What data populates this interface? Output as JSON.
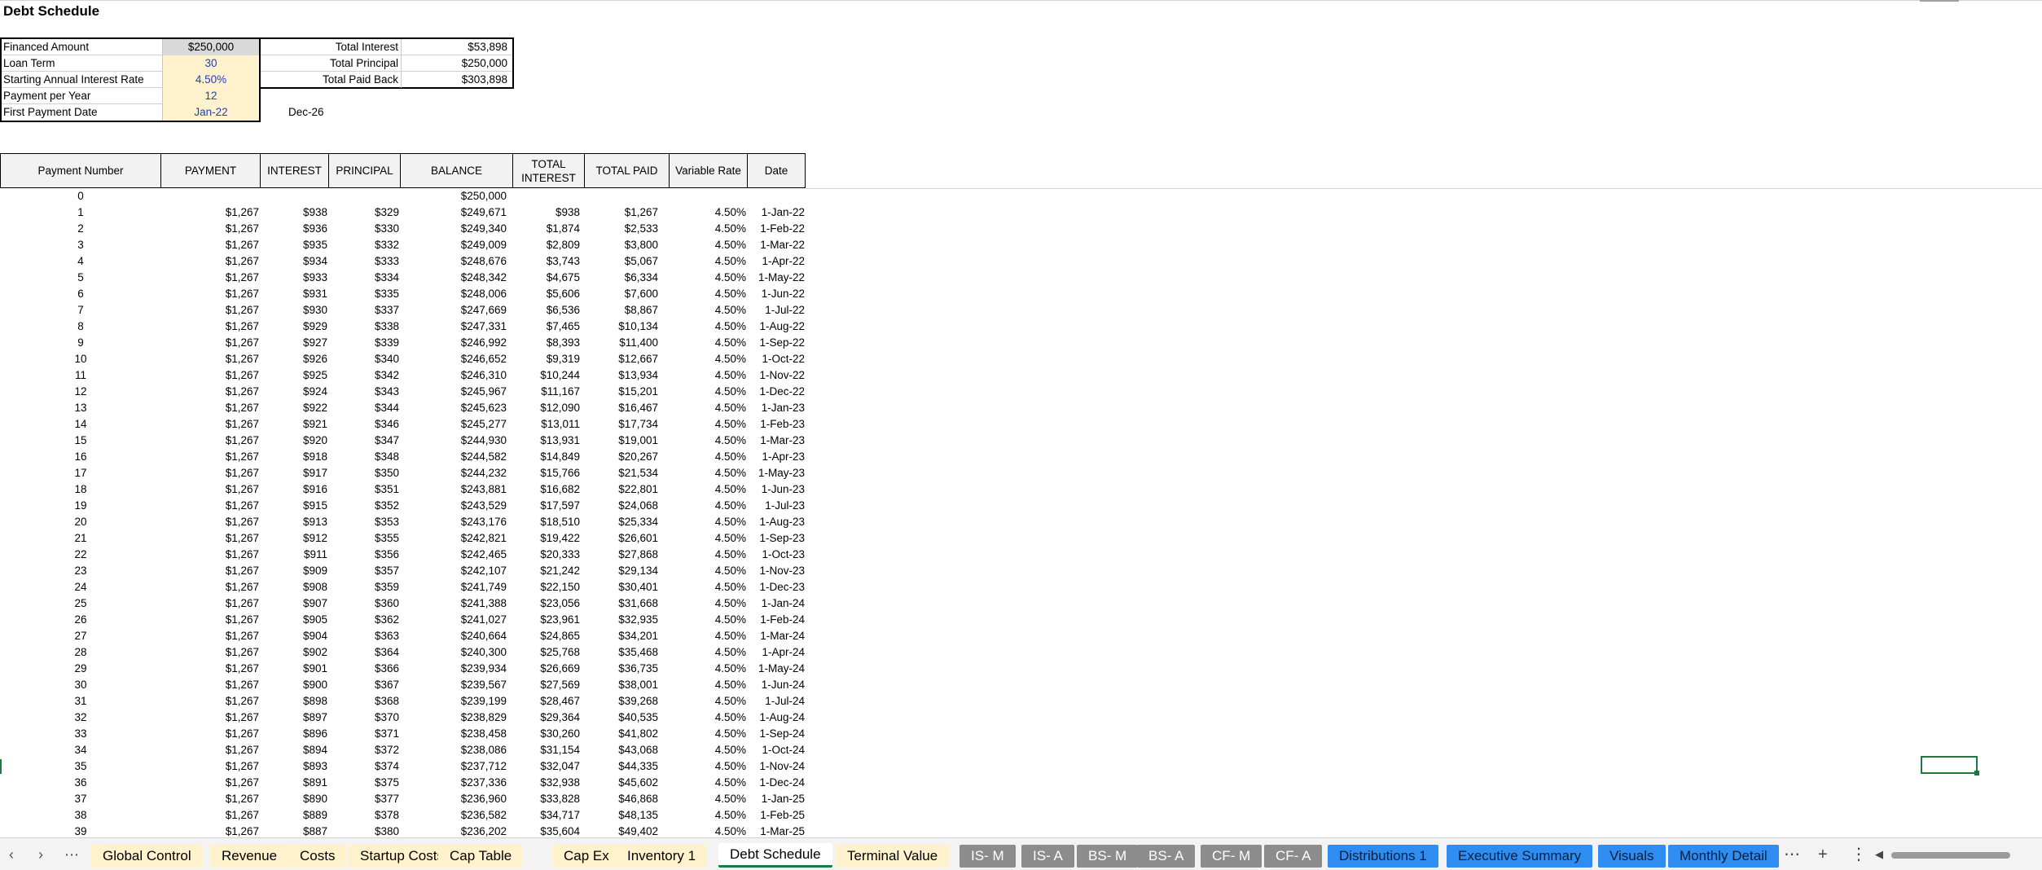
{
  "title": "Debt Schedule",
  "inputs": [
    {
      "label": "Financed Amount",
      "value": "$250,000",
      "style": "gray"
    },
    {
      "label": "Loan Term",
      "value": "30",
      "style": "yellow"
    },
    {
      "label": "Starting Annual Interest Rate",
      "value": "4.50%",
      "style": "yellow"
    },
    {
      "label": "Payment per Year",
      "value": "12",
      "style": "yellow"
    },
    {
      "label": "First Payment Date",
      "value": "Jan-22",
      "style": "yellow"
    }
  ],
  "totals": [
    {
      "label": "Total Interest",
      "value": "$53,898"
    },
    {
      "label": "Total Principal",
      "value": "$250,000"
    },
    {
      "label": "Total Paid Back",
      "value": "$303,898"
    }
  ],
  "end_date": "Dec-26",
  "columns": [
    "Payment Number",
    "PAYMENT",
    "INTEREST",
    "PRINCIPAL",
    "BALANCE",
    "TOTAL INTEREST",
    "TOTAL PAID",
    "Variable  Rate",
    "Date"
  ],
  "rows": [
    [
      "0",
      "",
      "",
      "",
      "$250,000",
      "",
      "",
      "",
      ""
    ],
    [
      "1",
      "$1,267",
      "$938",
      "$329",
      "$249,671",
      "$938",
      "$1,267",
      "4.50%",
      "1-Jan-22"
    ],
    [
      "2",
      "$1,267",
      "$936",
      "$330",
      "$249,340",
      "$1,874",
      "$2,533",
      "4.50%",
      "1-Feb-22"
    ],
    [
      "3",
      "$1,267",
      "$935",
      "$332",
      "$249,009",
      "$2,809",
      "$3,800",
      "4.50%",
      "1-Mar-22"
    ],
    [
      "4",
      "$1,267",
      "$934",
      "$333",
      "$248,676",
      "$3,743",
      "$5,067",
      "4.50%",
      "1-Apr-22"
    ],
    [
      "5",
      "$1,267",
      "$933",
      "$334",
      "$248,342",
      "$4,675",
      "$6,334",
      "4.50%",
      "1-May-22"
    ],
    [
      "6",
      "$1,267",
      "$931",
      "$335",
      "$248,006",
      "$5,606",
      "$7,600",
      "4.50%",
      "1-Jun-22"
    ],
    [
      "7",
      "$1,267",
      "$930",
      "$337",
      "$247,669",
      "$6,536",
      "$8,867",
      "4.50%",
      "1-Jul-22"
    ],
    [
      "8",
      "$1,267",
      "$929",
      "$338",
      "$247,331",
      "$7,465",
      "$10,134",
      "4.50%",
      "1-Aug-22"
    ],
    [
      "9",
      "$1,267",
      "$927",
      "$339",
      "$246,992",
      "$8,393",
      "$11,400",
      "4.50%",
      "1-Sep-22"
    ],
    [
      "10",
      "$1,267",
      "$926",
      "$340",
      "$246,652",
      "$9,319",
      "$12,667",
      "4.50%",
      "1-Oct-22"
    ],
    [
      "11",
      "$1,267",
      "$925",
      "$342",
      "$246,310",
      "$10,244",
      "$13,934",
      "4.50%",
      "1-Nov-22"
    ],
    [
      "12",
      "$1,267",
      "$924",
      "$343",
      "$245,967",
      "$11,167",
      "$15,201",
      "4.50%",
      "1-Dec-22"
    ],
    [
      "13",
      "$1,267",
      "$922",
      "$344",
      "$245,623",
      "$12,090",
      "$16,467",
      "4.50%",
      "1-Jan-23"
    ],
    [
      "14",
      "$1,267",
      "$921",
      "$346",
      "$245,277",
      "$13,011",
      "$17,734",
      "4.50%",
      "1-Feb-23"
    ],
    [
      "15",
      "$1,267",
      "$920",
      "$347",
      "$244,930",
      "$13,931",
      "$19,001",
      "4.50%",
      "1-Mar-23"
    ],
    [
      "16",
      "$1,267",
      "$918",
      "$348",
      "$244,582",
      "$14,849",
      "$20,267",
      "4.50%",
      "1-Apr-23"
    ],
    [
      "17",
      "$1,267",
      "$917",
      "$350",
      "$244,232",
      "$15,766",
      "$21,534",
      "4.50%",
      "1-May-23"
    ],
    [
      "18",
      "$1,267",
      "$916",
      "$351",
      "$243,881",
      "$16,682",
      "$22,801",
      "4.50%",
      "1-Jun-23"
    ],
    [
      "19",
      "$1,267",
      "$915",
      "$352",
      "$243,529",
      "$17,597",
      "$24,068",
      "4.50%",
      "1-Jul-23"
    ],
    [
      "20",
      "$1,267",
      "$913",
      "$353",
      "$243,176",
      "$18,510",
      "$25,334",
      "4.50%",
      "1-Aug-23"
    ],
    [
      "21",
      "$1,267",
      "$912",
      "$355",
      "$242,821",
      "$19,422",
      "$26,601",
      "4.50%",
      "1-Sep-23"
    ],
    [
      "22",
      "$1,267",
      "$911",
      "$356",
      "$242,465",
      "$20,333",
      "$27,868",
      "4.50%",
      "1-Oct-23"
    ],
    [
      "23",
      "$1,267",
      "$909",
      "$357",
      "$242,107",
      "$21,242",
      "$29,134",
      "4.50%",
      "1-Nov-23"
    ],
    [
      "24",
      "$1,267",
      "$908",
      "$359",
      "$241,749",
      "$22,150",
      "$30,401",
      "4.50%",
      "1-Dec-23"
    ],
    [
      "25",
      "$1,267",
      "$907",
      "$360",
      "$241,388",
      "$23,056",
      "$31,668",
      "4.50%",
      "1-Jan-24"
    ],
    [
      "26",
      "$1,267",
      "$905",
      "$362",
      "$241,027",
      "$23,961",
      "$32,935",
      "4.50%",
      "1-Feb-24"
    ],
    [
      "27",
      "$1,267",
      "$904",
      "$363",
      "$240,664",
      "$24,865",
      "$34,201",
      "4.50%",
      "1-Mar-24"
    ],
    [
      "28",
      "$1,267",
      "$902",
      "$364",
      "$240,300",
      "$25,768",
      "$35,468",
      "4.50%",
      "1-Apr-24"
    ],
    [
      "29",
      "$1,267",
      "$901",
      "$366",
      "$239,934",
      "$26,669",
      "$36,735",
      "4.50%",
      "1-May-24"
    ],
    [
      "30",
      "$1,267",
      "$900",
      "$367",
      "$239,567",
      "$27,569",
      "$38,001",
      "4.50%",
      "1-Jun-24"
    ],
    [
      "31",
      "$1,267",
      "$898",
      "$368",
      "$239,199",
      "$28,467",
      "$39,268",
      "4.50%",
      "1-Jul-24"
    ],
    [
      "32",
      "$1,267",
      "$897",
      "$370",
      "$238,829",
      "$29,364",
      "$40,535",
      "4.50%",
      "1-Aug-24"
    ],
    [
      "33",
      "$1,267",
      "$896",
      "$371",
      "$238,458",
      "$30,260",
      "$41,802",
      "4.50%",
      "1-Sep-24"
    ],
    [
      "34",
      "$1,267",
      "$894",
      "$372",
      "$238,086",
      "$31,154",
      "$43,068",
      "4.50%",
      "1-Oct-24"
    ],
    [
      "35",
      "$1,267",
      "$893",
      "$374",
      "$237,712",
      "$32,047",
      "$44,335",
      "4.50%",
      "1-Nov-24"
    ],
    [
      "36",
      "$1,267",
      "$891",
      "$375",
      "$237,336",
      "$32,938",
      "$45,602",
      "4.50%",
      "1-Dec-24"
    ],
    [
      "37",
      "$1,267",
      "$890",
      "$377",
      "$236,960",
      "$33,828",
      "$46,868",
      "4.50%",
      "1-Jan-25"
    ],
    [
      "38",
      "$1,267",
      "$889",
      "$378",
      "$236,582",
      "$34,717",
      "$48,135",
      "4.50%",
      "1-Feb-25"
    ],
    [
      "39",
      "$1,267",
      "$887",
      "$380",
      "$236,202",
      "$35,604",
      "$49,402",
      "4.50%",
      "1-Mar-25"
    ]
  ],
  "tabbar": {
    "prev_icon": "‹",
    "next_icon": "›",
    "more_icon": "⋯",
    "add_icon": "+",
    "options_icon": "⋮",
    "scroll_left_icon": "◀",
    "tabs": [
      {
        "label": "Global Control",
        "style": "yellow"
      },
      {
        "label": "Revenue",
        "style": "yellow"
      },
      {
        "label": "Costs",
        "style": "yellow"
      },
      {
        "label": "Startup Costs",
        "style": "yellow"
      },
      {
        "label": "Cap Table",
        "style": "yellow"
      },
      {
        "label": "Cap Ex",
        "style": "yellow"
      },
      {
        "label": "Inventory 1",
        "style": "yellow"
      },
      {
        "label": "Debt Schedule",
        "style": "active"
      },
      {
        "label": "Terminal Value",
        "style": "yellow"
      },
      {
        "label": "IS- M",
        "style": "gray"
      },
      {
        "label": "IS- A",
        "style": "gray"
      },
      {
        "label": "BS- M",
        "style": "gray"
      },
      {
        "label": "BS- A",
        "style": "gray"
      },
      {
        "label": "CF- M",
        "style": "gray"
      },
      {
        "label": "CF- A",
        "style": "gray"
      },
      {
        "label": "Distributions 1",
        "style": "blue"
      },
      {
        "label": "Executive Summary",
        "style": "blue"
      },
      {
        "label": "Visuals",
        "style": "blue"
      },
      {
        "label": "Monthly Detail",
        "style": "blue"
      }
    ]
  },
  "colors": {
    "input_yellow": "#fff2cc",
    "input_gray": "#d9d9d9",
    "input_text_blue": "#1f3fbf",
    "tab_blue": "#2f8cf0",
    "tab_gray": "#8c8c8c",
    "selection_green": "#1d7a3f"
  }
}
